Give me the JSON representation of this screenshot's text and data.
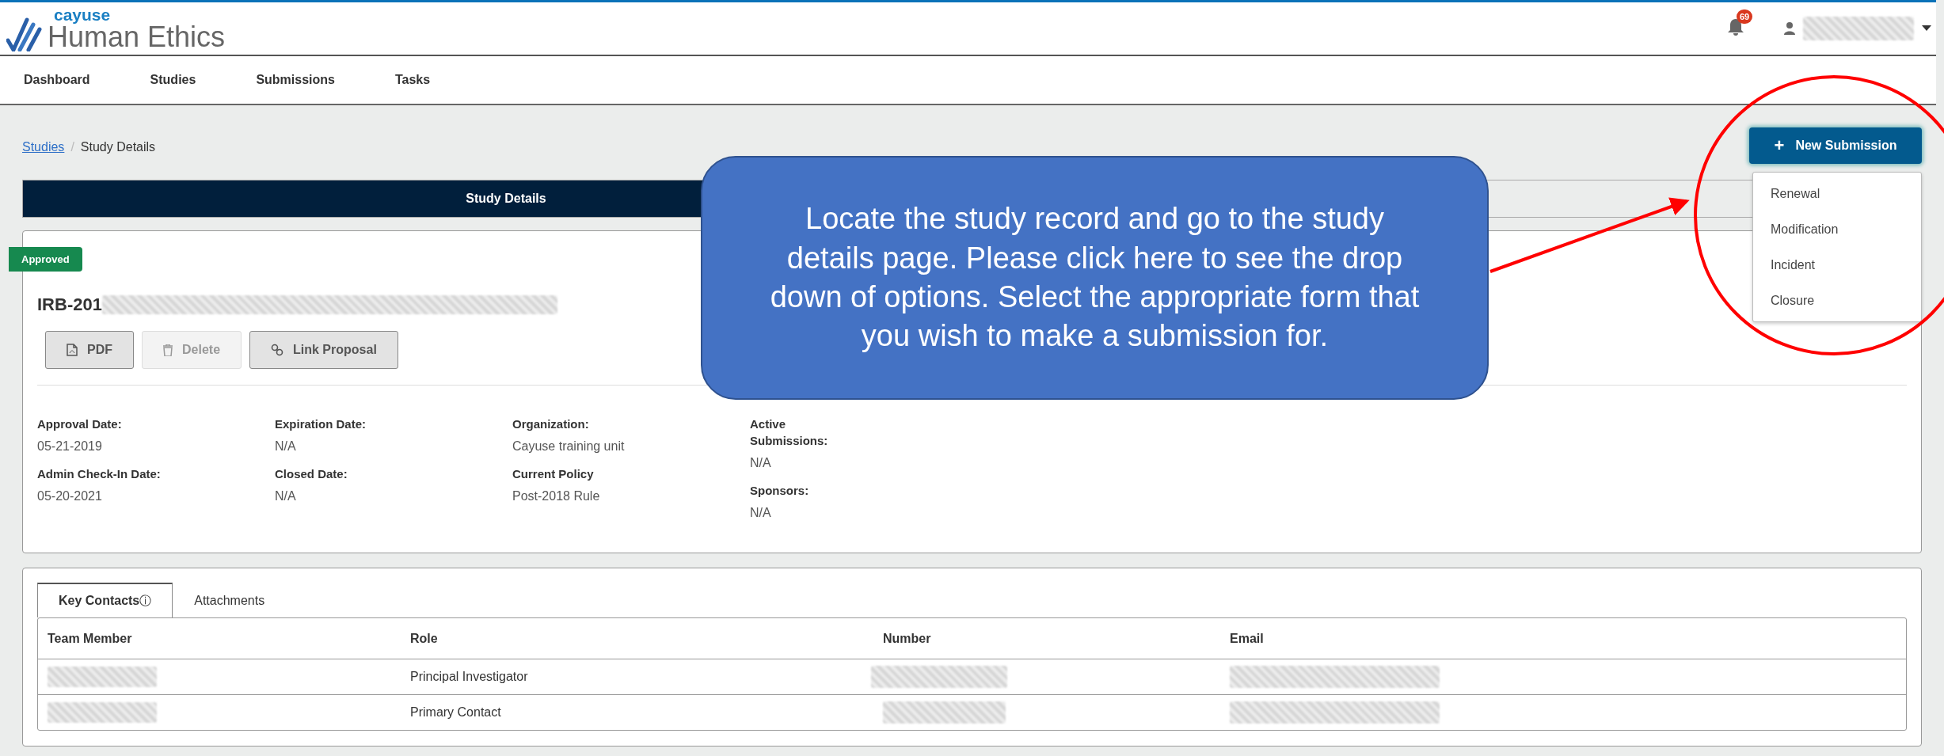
{
  "header": {
    "brand_small": "cayuse",
    "brand_title": "Human Ethics",
    "notification_count": "69"
  },
  "nav": [
    {
      "label": "Dashboard"
    },
    {
      "label": "Studies"
    },
    {
      "label": "Submissions"
    },
    {
      "label": "Tasks"
    }
  ],
  "breadcrumb": {
    "link": "Studies",
    "separator": "/",
    "current": "Study Details"
  },
  "new_submission": {
    "label": "New Submission",
    "icon_text": "+",
    "expanded": true,
    "options": [
      "Renewal",
      "Modification",
      "Incident",
      "Closure"
    ]
  },
  "page_tabs": [
    {
      "label": "Study Details",
      "selected": true
    }
  ],
  "study": {
    "status": "Approved",
    "id": "IRB-201",
    "buttons": [
      {
        "label": "PDF",
        "kind": "pdf",
        "disabled": false
      },
      {
        "label": "Delete",
        "kind": "delete",
        "disabled": true
      },
      {
        "label": "Link Proposal",
        "kind": "link",
        "disabled": false
      }
    ],
    "field_columns": [
      [
        {
          "label": "Approval Date:",
          "value": "05-21-2019"
        },
        {
          "label": "Admin Check-In Date:",
          "value": "05-20-2021"
        }
      ],
      [
        {
          "label": "Expiration Date:",
          "value": "N/A"
        },
        {
          "label": "Closed Date:",
          "value": "N/A"
        }
      ],
      [
        {
          "label": "Organization:",
          "value": "Cayuse training unit"
        },
        {
          "label": "Current Policy",
          "value": "Post-2018 Rule"
        }
      ],
      [
        {
          "label": "Active Submissions:",
          "value": "N/A"
        },
        {
          "label": "Sponsors:",
          "value": "N/A"
        }
      ]
    ]
  },
  "contacts": {
    "tabs": [
      {
        "label": "Key Contacts",
        "info": "ⓘ",
        "selected": true
      },
      {
        "label": "Attachments",
        "selected": false
      }
    ],
    "columns": [
      "Team Member",
      "Role",
      "Number",
      "Email"
    ],
    "rows": [
      {
        "role": "Principal Investigator"
      },
      {
        "role": "Primary Contact"
      }
    ]
  },
  "callout": {
    "text": "Locate the study record and go to the study details page. Please click here to see the drop down of options. Select the appropriate form that you wish to make a submission for."
  }
}
